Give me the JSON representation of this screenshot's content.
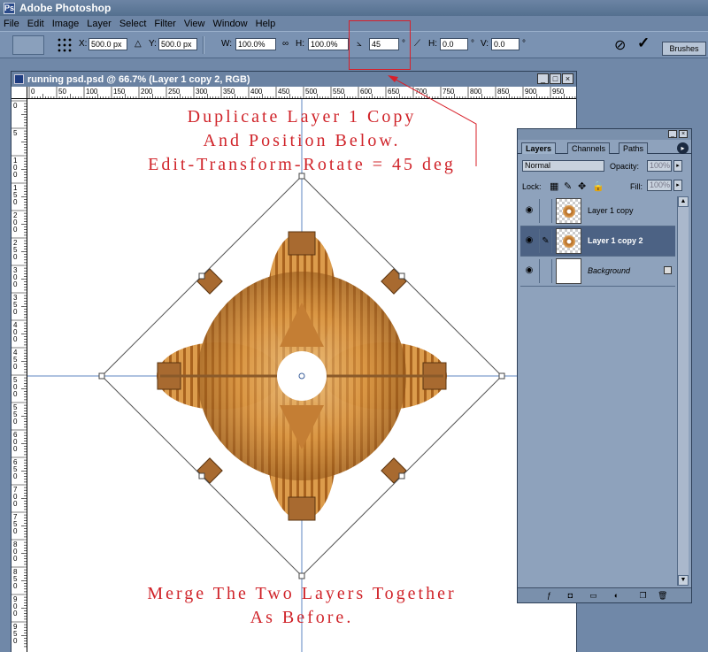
{
  "app": {
    "title": "Adobe Photoshop"
  },
  "menu": [
    "File",
    "Edit",
    "Image",
    "Layer",
    "Select",
    "Filter",
    "View",
    "Window",
    "Help"
  ],
  "options": {
    "x_label": "X:",
    "x_value": "500.0 px",
    "y_label": "Y:",
    "y_value": "500.0 px",
    "w_label": "W:",
    "w_value": "100.0%",
    "h_label": "H:",
    "h_value": "100.0%",
    "angle_value": "45",
    "angle_unit": "°",
    "skew_h_label": "H:",
    "skew_h_value": "0.0",
    "skew_h_unit": "°",
    "skew_v_label": "V:",
    "skew_v_value": "0.0",
    "skew_v_unit": "°",
    "brushes_tab": "Brushes"
  },
  "document": {
    "title": "running psd.psd @ 66.7% (Layer 1 copy 2, RGB)",
    "ruler_h": [
      "0",
      "50",
      "100",
      "150",
      "200",
      "250",
      "300",
      "350",
      "400",
      "450",
      "500",
      "550",
      "600",
      "650",
      "700",
      "750",
      "800",
      "850",
      "900",
      "950"
    ],
    "ruler_v": [
      "0",
      "5",
      "1\n0\n0",
      "1\n5\n0",
      "2\n0\n0",
      "2\n5\n0",
      "3\n0\n0",
      "3\n5\n0",
      "4\n0\n0",
      "4\n5\n0",
      "5\n0\n0",
      "5\n5\n0",
      "6\n0\n0",
      "6\n5\n0",
      "7\n0\n0",
      "7\n5\n0",
      "8\n0\n0",
      "8\n5\n0",
      "9\n0\n0",
      "9\n5\n0"
    ],
    "annotation_top": [
      "Duplicate Layer 1 Copy",
      "And Position Below.",
      "Edit-Transform-Rotate = 45 deg"
    ],
    "annotation_bottom": [
      "Merge The Two Layers Together",
      "As Before."
    ]
  },
  "layers_panel": {
    "tabs": [
      "Layers",
      "Channels",
      "Paths"
    ],
    "blend_mode": "Normal",
    "opacity_label": "Opacity:",
    "opacity_value": "100%",
    "lock_label": "Lock:",
    "fill_label": "Fill:",
    "fill_value": "100%",
    "layers": [
      {
        "name": "Layer 1 copy",
        "selected": false
      },
      {
        "name": "Layer 1 copy 2",
        "selected": true
      },
      {
        "name": "Background",
        "selected": false
      }
    ]
  },
  "colors": {
    "annotation": "#d0242a",
    "highlight": "#d8202a",
    "selected_layer": "#4c6284"
  }
}
